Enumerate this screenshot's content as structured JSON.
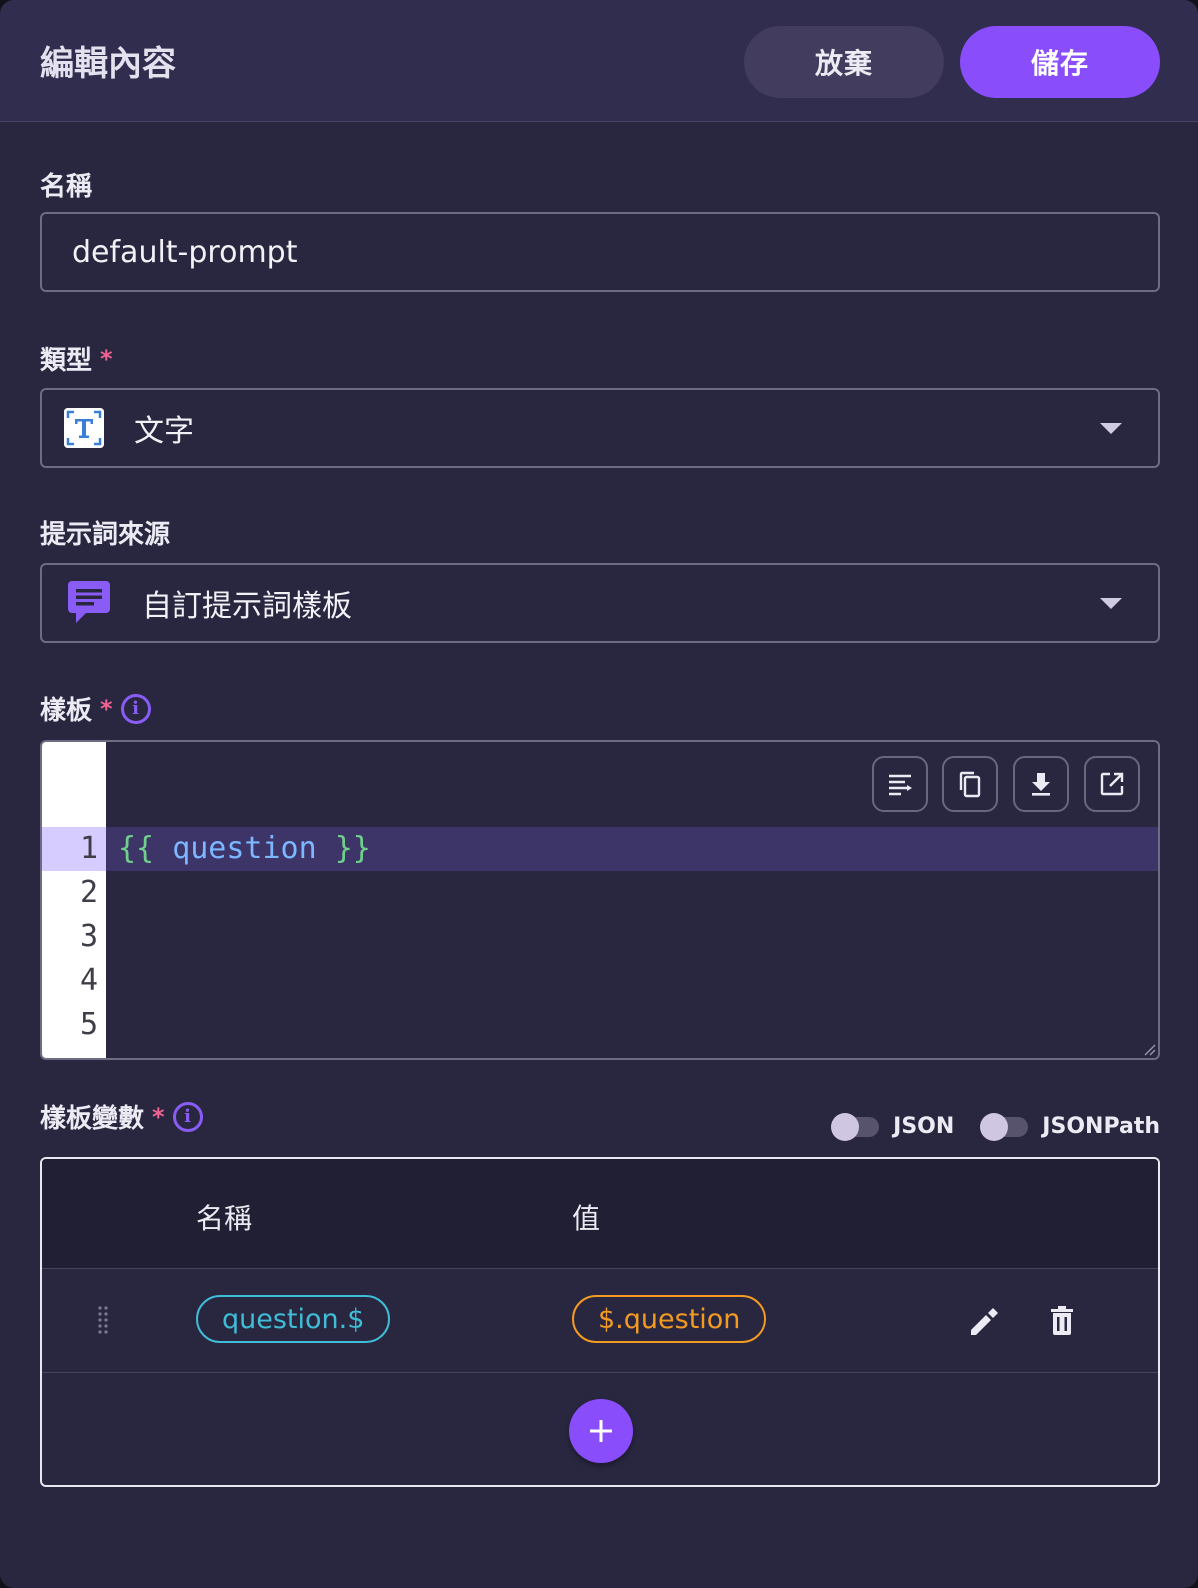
{
  "header": {
    "title": "編輯內容",
    "discard_label": "放棄",
    "save_label": "儲存"
  },
  "name_field": {
    "label": "名稱",
    "value": "default-prompt"
  },
  "type_field": {
    "label": "類型",
    "required_mark": "*",
    "icon": "text-type-icon",
    "value": "文字"
  },
  "source_field": {
    "label": "提示詞來源",
    "icon": "chat-message-icon",
    "value": "自訂提示詞樣板"
  },
  "template_field": {
    "label": "樣板",
    "required_mark": "*",
    "line_numbers": [
      "1",
      "2",
      "3",
      "4",
      "5"
    ],
    "code": {
      "open": "{{",
      "ident": "question",
      "close": "}}"
    },
    "toolbar": [
      "wrap-icon",
      "copy-icon",
      "download-icon",
      "open-external-icon"
    ]
  },
  "variables": {
    "label": "樣板變數",
    "required_mark": "*",
    "toggle_json_label": "JSON",
    "toggle_jsonpath_label": "JSONPath",
    "columns": {
      "name": "名稱",
      "value": "值"
    },
    "rows": [
      {
        "name": "question.$",
        "value": "$.question"
      }
    ]
  },
  "colors": {
    "accent": "#8a4dfc",
    "name_chip": "#3fbcd6",
    "value_chip": "#f29a21",
    "required": "#f06291"
  }
}
